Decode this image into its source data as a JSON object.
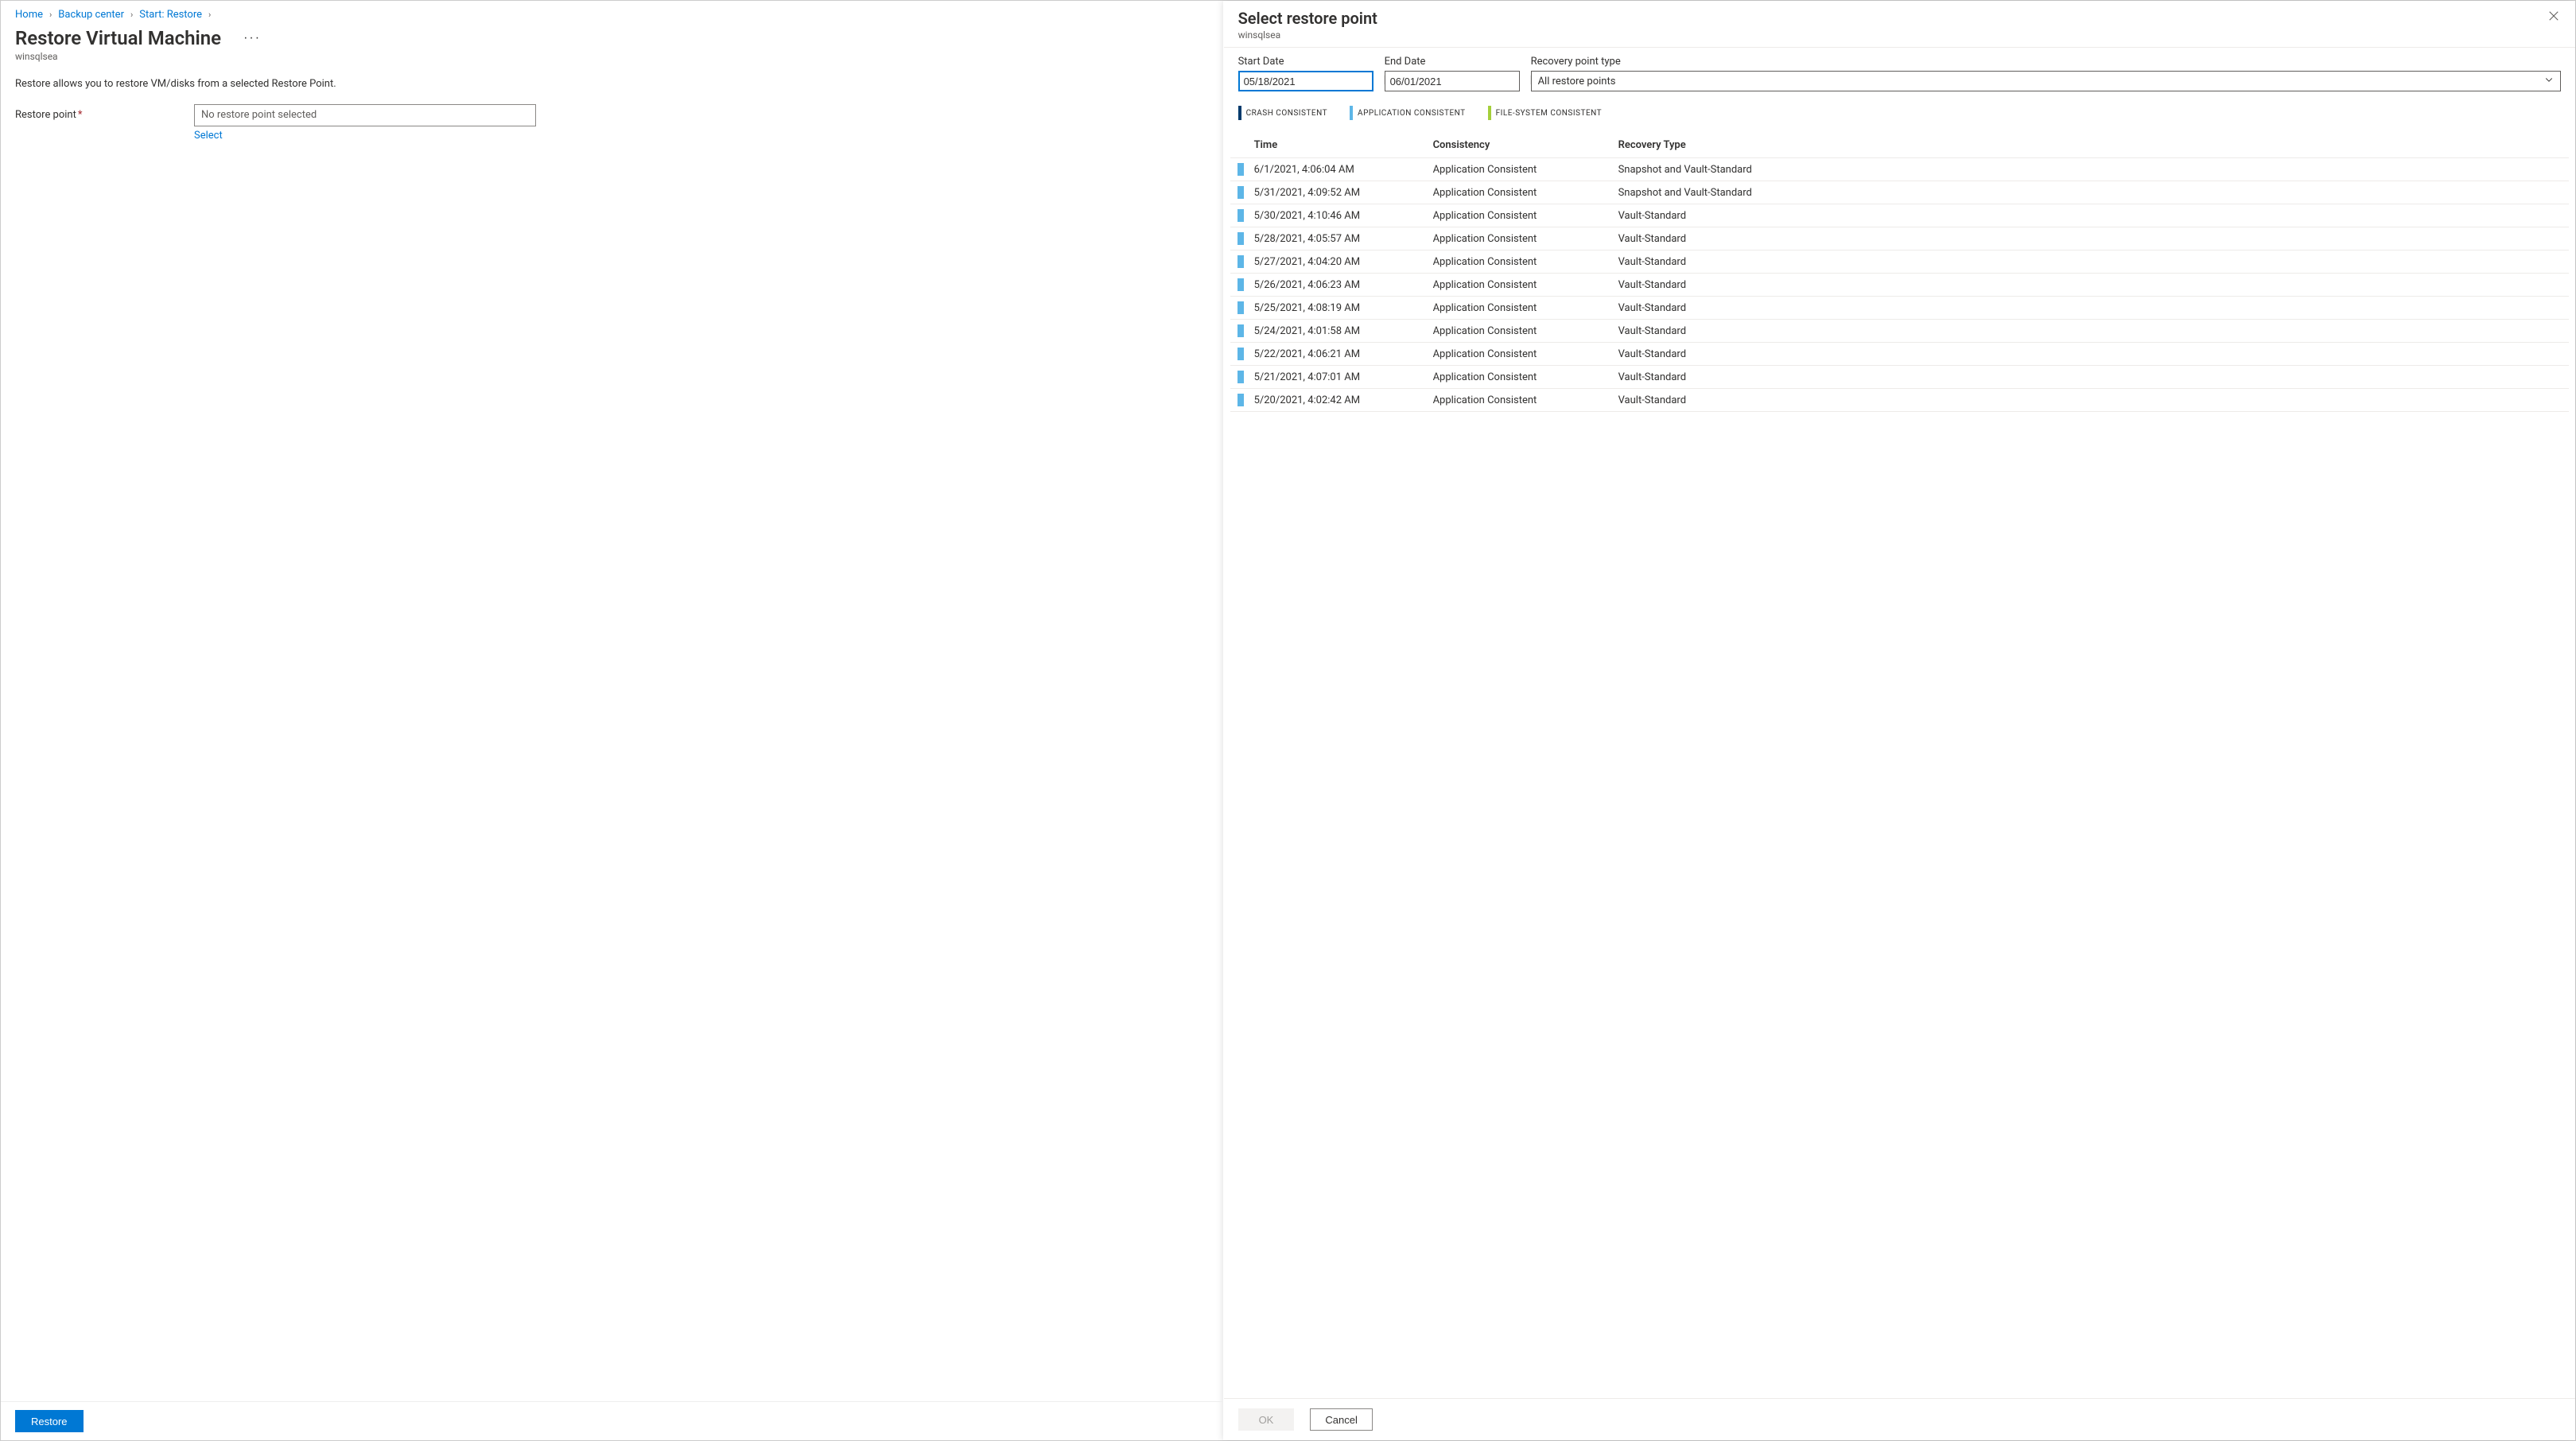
{
  "breadcrumb": [
    {
      "label": "Home"
    },
    {
      "label": "Backup center"
    },
    {
      "label": "Start: Restore"
    }
  ],
  "page": {
    "title": "Restore Virtual Machine",
    "resource": "winsqlsea",
    "description": "Restore allows you to restore VM/disks from a selected Restore Point."
  },
  "form": {
    "restore_point_label": "Restore point",
    "restore_point_value": "No restore point selected",
    "select_link": "Select"
  },
  "footer": {
    "restore_label": "Restore"
  },
  "panel": {
    "title": "Select restore point",
    "resource": "winsqlsea",
    "filters": {
      "start_date_label": "Start Date",
      "start_date_value": "05/18/2021",
      "end_date_label": "End Date",
      "end_date_value": "06/01/2021",
      "rp_type_label": "Recovery point type",
      "rp_type_value": "All restore points"
    },
    "legend": {
      "crash": "CRASH CONSISTENT",
      "app": "APPLICATION CONSISTENT",
      "fs": "FILE-SYSTEM CONSISTENT"
    },
    "columns": {
      "time": "Time",
      "consistency": "Consistency",
      "recovery_type": "Recovery Type"
    },
    "rows": [
      {
        "time": "6/1/2021, 4:06:04 AM",
        "consistency": "Application Consistent",
        "recovery_type": "Snapshot and Vault-Standard",
        "color": "app"
      },
      {
        "time": "5/31/2021, 4:09:52 AM",
        "consistency": "Application Consistent",
        "recovery_type": "Snapshot and Vault-Standard",
        "color": "app"
      },
      {
        "time": "5/30/2021, 4:10:46 AM",
        "consistency": "Application Consistent",
        "recovery_type": "Vault-Standard",
        "color": "app"
      },
      {
        "time": "5/28/2021, 4:05:57 AM",
        "consistency": "Application Consistent",
        "recovery_type": "Vault-Standard",
        "color": "app"
      },
      {
        "time": "5/27/2021, 4:04:20 AM",
        "consistency": "Application Consistent",
        "recovery_type": "Vault-Standard",
        "color": "app"
      },
      {
        "time": "5/26/2021, 4:06:23 AM",
        "consistency": "Application Consistent",
        "recovery_type": "Vault-Standard",
        "color": "app"
      },
      {
        "time": "5/25/2021, 4:08:19 AM",
        "consistency": "Application Consistent",
        "recovery_type": "Vault-Standard",
        "color": "app"
      },
      {
        "time": "5/24/2021, 4:01:58 AM",
        "consistency": "Application Consistent",
        "recovery_type": "Vault-Standard",
        "color": "app"
      },
      {
        "time": "5/22/2021, 4:06:21 AM",
        "consistency": "Application Consistent",
        "recovery_type": "Vault-Standard",
        "color": "app"
      },
      {
        "time": "5/21/2021, 4:07:01 AM",
        "consistency": "Application Consistent",
        "recovery_type": "Vault-Standard",
        "color": "app"
      },
      {
        "time": "5/20/2021, 4:02:42 AM",
        "consistency": "Application Consistent",
        "recovery_type": "Vault-Standard",
        "color": "app"
      }
    ],
    "footer": {
      "ok": "OK",
      "cancel": "Cancel"
    }
  }
}
